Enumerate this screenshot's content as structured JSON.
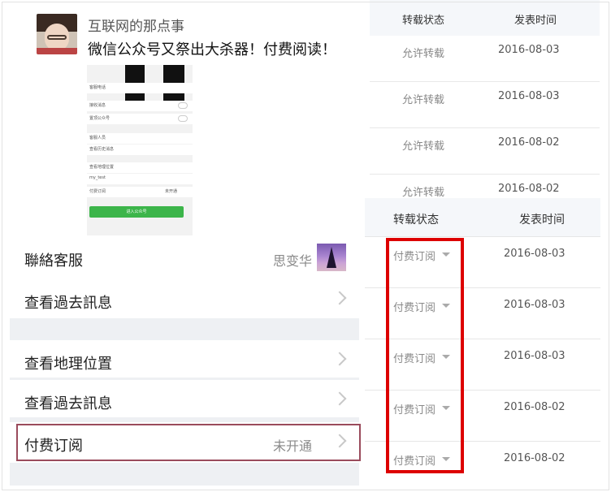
{
  "post": {
    "account_name": "互联网的那点事",
    "title": "微信公众号又祭出大杀器！付费阅读！"
  },
  "phone_screen": {
    "rows": [
      {
        "label": "客服电话"
      },
      {
        "label": "接收消息"
      },
      {
        "label": "置顶公众号"
      },
      {
        "label": "客服人员"
      },
      {
        "label": "查看历史消息"
      },
      {
        "label": "查看地理位置"
      },
      {
        "label": "my_test"
      },
      {
        "label": "付费订阅",
        "value": "未开通"
      }
    ],
    "enter_button": "进入公众号"
  },
  "menu": {
    "items": [
      {
        "label": "聯絡客服",
        "value": "思变华"
      },
      {
        "label": "查看過去訊息"
      },
      {
        "label": "查看地理位置"
      },
      {
        "label": "查看過去訊息"
      },
      {
        "label": "付费订阅",
        "value": "未开通"
      }
    ]
  },
  "table_allow": {
    "headers": {
      "status": "转载状态",
      "date": "发表时间"
    },
    "rows": [
      {
        "status": "允许转载",
        "date": "2016-08-03"
      },
      {
        "status": "允许转载",
        "date": "2016-08-03"
      },
      {
        "status": "允许转载",
        "date": "2016-08-02"
      },
      {
        "status": "允许转载",
        "date": "2016-08-02"
      }
    ]
  },
  "table_paid": {
    "headers": {
      "status": "转载状态",
      "date": "发表时间"
    },
    "rows": [
      {
        "status": "付费订阅",
        "date": "2016-08-03"
      },
      {
        "status": "付费订阅",
        "date": "2016-08-03"
      },
      {
        "status": "付费订阅",
        "date": "2016-08-03"
      },
      {
        "status": "付费订阅",
        "date": "2016-08-02"
      },
      {
        "status": "付费订阅",
        "date": "2016-08-02"
      }
    ]
  },
  "colors": {
    "highlight_red": "#dd0000",
    "menu_highlight": "#9a4b5c",
    "enter_button_green": "#3cb54a"
  }
}
